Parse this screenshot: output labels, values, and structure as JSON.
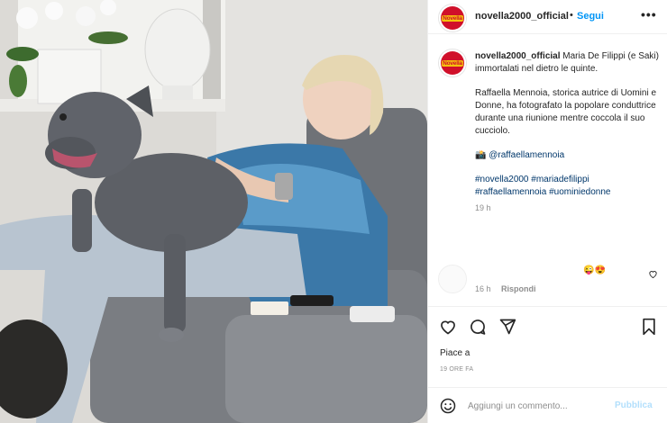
{
  "post": {
    "username": "novella2000_official",
    "follow_label": "Segui",
    "separator": "•",
    "more_label": "•••",
    "logo_text": "Novella",
    "caption_intro": "Maria De Filippi (e Saki) immortalati nel dietro le quinte.",
    "caption_body": "Raffaella Mennoia, storica autrice di Uomini e Donne, ha fotografato la popolare conduttrice durante una riunione mentre coccola il suo cucciolo.",
    "camera_emoji": "📸",
    "mention": "@raffaellamennoia",
    "hashtags": "#novella2000 #mariadefilippi #raffaellamennoia #uominiedonne",
    "caption_time": "19 h"
  },
  "comment": {
    "emoji": "😜😍",
    "time": "16 h",
    "reply_label": "Rispondi"
  },
  "actions": {
    "likes_label": "Piace a",
    "posted_time": "19 ORE FA"
  },
  "add_comment": {
    "placeholder": "Aggiungi un commento...",
    "publish_label": "Pubblica"
  },
  "colors": {
    "link_blue": "#0095f6",
    "hashtag": "#00376b",
    "muted": "#8e8e8e",
    "brand_red": "#d0102a"
  },
  "icons": [
    "heart-icon",
    "comment-icon",
    "share-icon",
    "bookmark-icon",
    "emoji-icon",
    "more-icon"
  ]
}
